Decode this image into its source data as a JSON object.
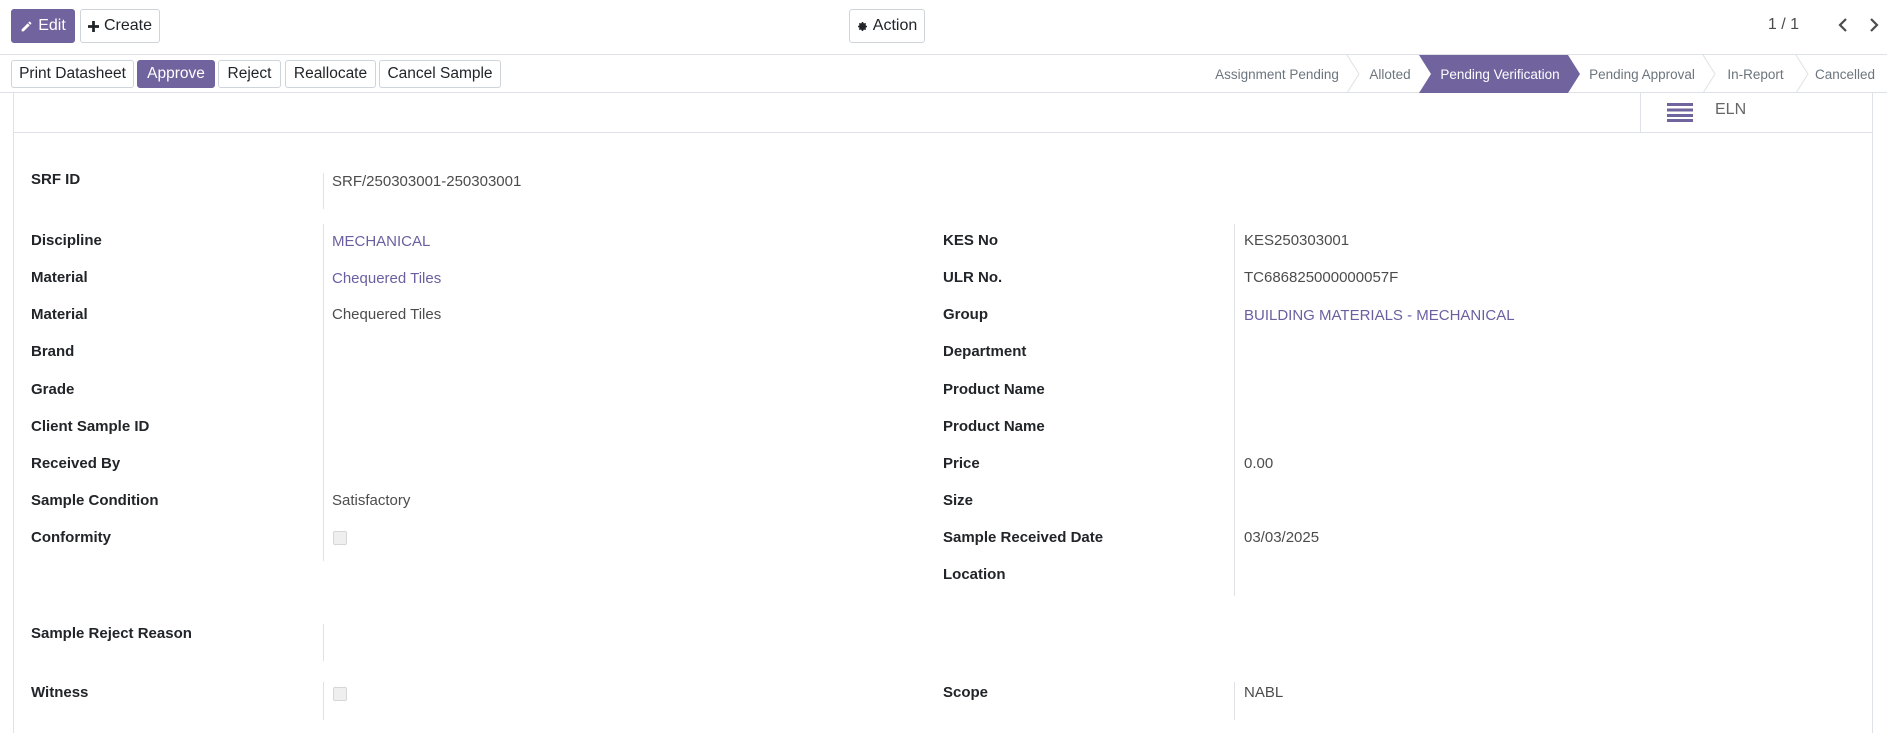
{
  "toolbar": {
    "edit_label": "Edit",
    "create_label": "Create",
    "action_label": "Action",
    "pager": "1 / 1"
  },
  "status_buttons": {
    "print_datasheet": "Print Datasheet",
    "approve": "Approve",
    "reject": "Reject",
    "reallocate": "Reallocate",
    "cancel_sample": "Cancel Sample"
  },
  "stages": [
    {
      "label": "Assignment Pending",
      "active": false
    },
    {
      "label": "Alloted",
      "active": false
    },
    {
      "label": "Pending Verification",
      "active": true
    },
    {
      "label": "Pending Approval",
      "active": false
    },
    {
      "label": "In-Report",
      "active": false
    },
    {
      "label": "Cancelled",
      "active": false
    }
  ],
  "button_box": {
    "eln_label": "ELN"
  },
  "form": {
    "srf_id": {
      "label": "SRF ID",
      "value": "SRF/250303001-250303001"
    },
    "left": [
      {
        "label": "Discipline",
        "value": "MECHANICAL",
        "link": true
      },
      {
        "label": "Material",
        "value": "Chequered Tiles",
        "link": true
      },
      {
        "label": "Material",
        "value": "Chequered Tiles",
        "link": false
      },
      {
        "label": "Brand",
        "value": "",
        "link": false
      },
      {
        "label": "Grade",
        "value": "",
        "link": false
      },
      {
        "label": "Client Sample ID",
        "value": "",
        "link": false
      },
      {
        "label": "Received By",
        "value": "",
        "link": false
      },
      {
        "label": "Sample Condition",
        "value": "Satisfactory",
        "link": false
      },
      {
        "label": "Conformity",
        "value": "",
        "checkbox": true
      }
    ],
    "right": [
      {
        "label": "KES No",
        "value": "KES250303001",
        "link": false
      },
      {
        "label": "ULR No.",
        "value": "TC686825000000057F",
        "link": false
      },
      {
        "label": "Group",
        "value": "BUILDING MATERIALS - MECHANICAL",
        "link": true
      },
      {
        "label": "Department",
        "value": "",
        "link": false
      },
      {
        "label": "Product Name",
        "value": "",
        "link": false
      },
      {
        "label": "Product Name",
        "value": "",
        "link": false
      },
      {
        "label": "Price",
        "value": "0.00",
        "link": false
      },
      {
        "label": "Size",
        "value": "",
        "link": false
      },
      {
        "label": "Sample Received Date",
        "value": "03/03/2025",
        "link": false
      },
      {
        "label": "Location",
        "value": "",
        "link": false
      }
    ],
    "sample_reject_reason": {
      "label": "Sample Reject Reason",
      "value": ""
    },
    "witness": {
      "label": "Witness",
      "checkbox": true
    },
    "scope": {
      "label": "Scope",
      "value": "NABL"
    }
  },
  "colors": {
    "brand": "#71639e",
    "link": "#6b5fa0"
  }
}
